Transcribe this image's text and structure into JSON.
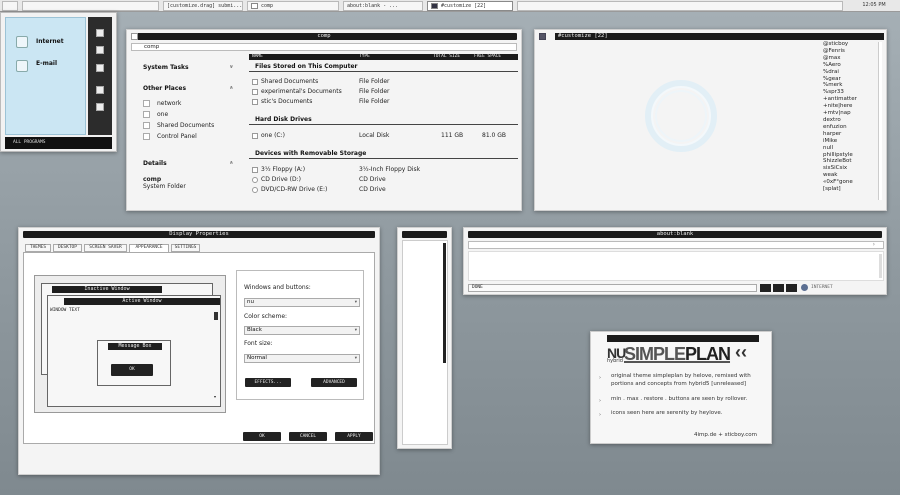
{
  "taskbar": {
    "items": [
      "[customize.drag] submi...",
      "comp",
      "about:blank - ...",
      "#customize [22]"
    ],
    "clock": "12:05 PM"
  },
  "start_menu": {
    "items": [
      "Internet",
      "E-mail"
    ],
    "all_programs": "ALL PROGRAMS"
  },
  "explorer": {
    "title": "comp",
    "address": "comp",
    "sidebar": {
      "system_tasks": "System Tasks",
      "other_places": "Other Places",
      "places": [
        "network",
        "one",
        "Shared Documents",
        "Control Panel"
      ],
      "details": "Details",
      "details_name": "comp",
      "details_type": "System Folder",
      "collapse_glyph": "»",
      "expand_glyph": "«"
    },
    "columns": [
      "NAME",
      "TYPE",
      "TOTAL SIZE",
      "FREE SPACE"
    ],
    "groups": [
      {
        "title": "Files Stored on This Computer"
      },
      {
        "title": "Hard Disk Drives"
      },
      {
        "title": "Devices with Removable Storage"
      }
    ],
    "stored_files": [
      {
        "name": "Shared Documents",
        "type": "File Folder"
      },
      {
        "name": "experimental's Documents",
        "type": "File Folder"
      },
      {
        "name": "stic's Documents",
        "type": "File Folder"
      }
    ],
    "hard_disks": [
      {
        "name": "one (C:)",
        "type": "Local Disk",
        "total": "111 GB",
        "free": "81.0 GB"
      }
    ],
    "removable": [
      {
        "name": "3½ Floppy (A:)",
        "type": "3½-Inch Floppy Disk"
      },
      {
        "name": "CD Drive (D:)",
        "type": "CD Drive"
      },
      {
        "name": "DVD/CD-RW Drive (E:)",
        "type": "CD Drive"
      }
    ]
  },
  "customize": {
    "title": "#customize [22]",
    "nicks": [
      "@sticboy",
      "@Fenris",
      "@max",
      "%Aero",
      "%drai",
      "%gear",
      "%merk",
      "%spr33",
      "+antimatter",
      "+nite|here",
      "+mtv|nap",
      "dextro",
      "enfuzion",
      "harper",
      "iMike",
      "null",
      "phillipstyle",
      "ShizzleBot",
      "sixSiCsix",
      "weak",
      "«0xF°gone",
      "[splat]"
    ]
  },
  "display_properties": {
    "title": "Display Properties",
    "tabs": [
      "THEMES",
      "DESKTOP",
      "SCREEN SAVER",
      "APPEARANCE",
      "SETTINGS"
    ],
    "preview": {
      "inactive_title": "Inactive Window",
      "active_title": "Active Window",
      "window_text": "WINDOW TEXT",
      "message_title": "Message Box",
      "ok": "OK"
    },
    "windows_and_buttons_label": "Windows and buttons:",
    "windows_and_buttons_value": "nu",
    "color_scheme_label": "Color scheme:",
    "color_scheme_value": "Black",
    "font_size_label": "Font size:",
    "font_size_value": "Normal",
    "effects_button": "EFFECTS...",
    "advanced_button": "ADVANCED",
    "ok_button": "OK",
    "cancel_button": "CANCEL",
    "apply_button": "APPLY"
  },
  "aboutblank": {
    "title": "about:blank",
    "status": "DONE",
    "zone": "INTERNET"
  },
  "info": {
    "logo_nu": "NU",
    "logo_hybrid": "hybrid",
    "logo_simple": "SIMPLE",
    "logo_plan": "PLAN",
    "logo_arrows": "‹‹",
    "lines": [
      "original theme simpleplan by helove, remixed with portions and concepts from hybrid5 [unreleased]",
      "min . max . restore . buttons are seen by rollover.",
      "icons seen here are serenity by heylove."
    ],
    "footer": "4imp.de + sticboy.com"
  },
  "colors": {
    "accent_dark": "#1b1b1b",
    "start_menu_blue": "#cbe6f3",
    "desktop_top": "#a6b0b6",
    "desktop_bottom": "#7f898f"
  }
}
